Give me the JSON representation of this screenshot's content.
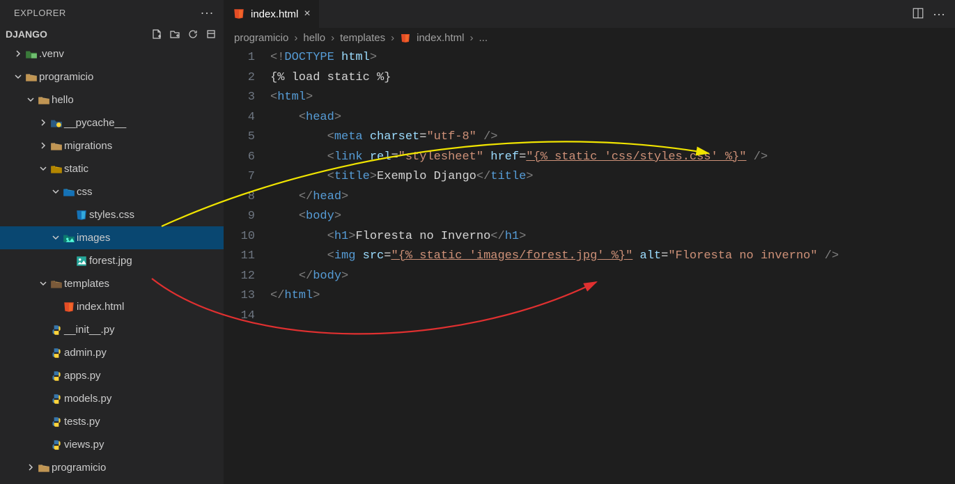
{
  "sidebar": {
    "title": "EXPLORER",
    "project": "DJANGO"
  },
  "tree": [
    {
      "indent": 0,
      "chev": "right",
      "icon": "folder-green",
      "label": ".venv"
    },
    {
      "indent": 0,
      "chev": "down",
      "icon": "folder",
      "label": "programicio"
    },
    {
      "indent": 1,
      "chev": "down",
      "icon": "folder",
      "label": "hello"
    },
    {
      "indent": 2,
      "chev": "right",
      "icon": "folder-py",
      "label": "__pycache__"
    },
    {
      "indent": 2,
      "chev": "right",
      "icon": "folder",
      "label": "migrations"
    },
    {
      "indent": 2,
      "chev": "down",
      "icon": "folder-yellow",
      "label": "static"
    },
    {
      "indent": 3,
      "chev": "down",
      "icon": "folder-css",
      "label": "css"
    },
    {
      "indent": 4,
      "chev": "",
      "icon": "css-file",
      "label": "styles.css"
    },
    {
      "indent": 3,
      "chev": "down",
      "icon": "folder-img",
      "label": "images",
      "selected": true
    },
    {
      "indent": 4,
      "chev": "",
      "icon": "img-file",
      "label": "forest.jpg"
    },
    {
      "indent": 2,
      "chev": "down",
      "icon": "folder-tpl",
      "label": "templates"
    },
    {
      "indent": 3,
      "chev": "",
      "icon": "html-file",
      "label": "index.html"
    },
    {
      "indent": 2,
      "chev": "",
      "icon": "py-file",
      "label": "__init__.py"
    },
    {
      "indent": 2,
      "chev": "",
      "icon": "py-file",
      "label": "admin.py"
    },
    {
      "indent": 2,
      "chev": "",
      "icon": "py-file",
      "label": "apps.py"
    },
    {
      "indent": 2,
      "chev": "",
      "icon": "py-file",
      "label": "models.py"
    },
    {
      "indent": 2,
      "chev": "",
      "icon": "py-file",
      "label": "tests.py"
    },
    {
      "indent": 2,
      "chev": "",
      "icon": "py-file",
      "label": "views.py"
    },
    {
      "indent": 1,
      "chev": "right",
      "icon": "folder",
      "label": "programicio"
    }
  ],
  "tab": {
    "label": "index.html"
  },
  "breadcrumb": [
    "programicio",
    "hello",
    "templates",
    "index.html",
    "..."
  ],
  "code": {
    "lines": [
      [
        [
          "tk-gray",
          "<!"
        ],
        [
          "tk-blue",
          "DOCTYPE"
        ],
        [
          "tk-white",
          " "
        ],
        [
          "tk-lblue",
          "html"
        ],
        [
          "tk-gray",
          ">"
        ]
      ],
      [
        [
          "tk-white",
          "{% load static %}"
        ]
      ],
      [
        [
          "tk-gray",
          "<"
        ],
        [
          "tk-blue",
          "html"
        ],
        [
          "tk-gray",
          ">"
        ]
      ],
      [
        [
          "tk-white",
          "    "
        ],
        [
          "tk-gray",
          "<"
        ],
        [
          "tk-blue",
          "head"
        ],
        [
          "tk-gray",
          ">"
        ]
      ],
      [
        [
          "tk-white",
          "        "
        ],
        [
          "tk-gray",
          "<"
        ],
        [
          "tk-blue",
          "meta"
        ],
        [
          "tk-white",
          " "
        ],
        [
          "tk-lblue",
          "charset"
        ],
        [
          "tk-white",
          "="
        ],
        [
          "tk-str",
          "\"utf-8\""
        ],
        [
          "tk-white",
          " "
        ],
        [
          "tk-gray",
          "/>"
        ]
      ],
      [
        [
          "tk-white",
          "        "
        ],
        [
          "tk-gray",
          "<"
        ],
        [
          "tk-blue",
          "link"
        ],
        [
          "tk-white",
          " "
        ],
        [
          "tk-lblue",
          "rel"
        ],
        [
          "tk-white",
          "="
        ],
        [
          "tk-str",
          "\"stylesheet\""
        ],
        [
          "tk-white",
          " "
        ],
        [
          "tk-lblue",
          "href"
        ],
        [
          "tk-white",
          "="
        ],
        [
          "tk-str underline",
          "\"{% static 'css/styles.css' %}\""
        ],
        [
          "tk-white",
          " "
        ],
        [
          "tk-gray",
          "/>"
        ]
      ],
      [
        [
          "tk-white",
          "        "
        ],
        [
          "tk-gray",
          "<"
        ],
        [
          "tk-blue",
          "title"
        ],
        [
          "tk-gray",
          ">"
        ],
        [
          "tk-white",
          "Exemplo Django"
        ],
        [
          "tk-gray",
          "</"
        ],
        [
          "tk-blue",
          "title"
        ],
        [
          "tk-gray",
          ">"
        ]
      ],
      [
        [
          "tk-white",
          "    "
        ],
        [
          "tk-gray",
          "</"
        ],
        [
          "tk-blue",
          "head"
        ],
        [
          "tk-gray",
          ">"
        ]
      ],
      [
        [
          "tk-white",
          "    "
        ],
        [
          "tk-gray",
          "<"
        ],
        [
          "tk-blue",
          "body"
        ],
        [
          "tk-gray",
          ">"
        ]
      ],
      [
        [
          "tk-white",
          "        "
        ],
        [
          "tk-gray",
          "<"
        ],
        [
          "tk-blue",
          "h1"
        ],
        [
          "tk-gray",
          ">"
        ],
        [
          "tk-white",
          "Floresta no Inverno"
        ],
        [
          "tk-gray",
          "</"
        ],
        [
          "tk-blue",
          "h1"
        ],
        [
          "tk-gray",
          ">"
        ]
      ],
      [
        [
          "tk-white",
          "        "
        ],
        [
          "tk-gray",
          "<"
        ],
        [
          "tk-blue",
          "img"
        ],
        [
          "tk-white",
          " "
        ],
        [
          "tk-lblue",
          "src"
        ],
        [
          "tk-white",
          "="
        ],
        [
          "tk-str underline",
          "\"{% static 'images/forest.jpg' %}\""
        ],
        [
          "tk-white",
          " "
        ],
        [
          "tk-lblue",
          "alt"
        ],
        [
          "tk-white",
          "="
        ],
        [
          "tk-str",
          "\"Floresta no inverno\""
        ],
        [
          "tk-white",
          " "
        ],
        [
          "tk-gray",
          "/>"
        ]
      ],
      [
        [
          "tk-white",
          "    "
        ],
        [
          "tk-gray",
          "</"
        ],
        [
          "tk-blue",
          "body"
        ],
        [
          "tk-gray",
          ">"
        ]
      ],
      [
        [
          "tk-gray",
          "</"
        ],
        [
          "tk-blue",
          "html"
        ],
        [
          "tk-gray",
          ">"
        ]
      ],
      [
        [
          "tk-white",
          ""
        ]
      ]
    ]
  }
}
